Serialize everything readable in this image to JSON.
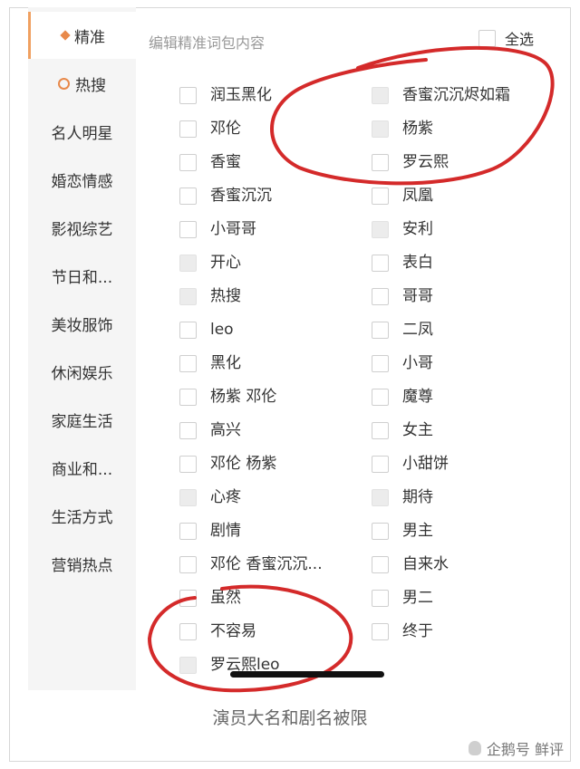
{
  "sidebar": {
    "items": [
      {
        "label": "精准",
        "icon": "diamond-icon",
        "active": true
      },
      {
        "label": "热搜",
        "icon": "flame-icon",
        "active": false
      },
      {
        "label": "名人明星"
      },
      {
        "label": "婚恋情感"
      },
      {
        "label": "影视综艺"
      },
      {
        "label": "节日和..."
      },
      {
        "label": "美妆服饰"
      },
      {
        "label": "休闲娱乐"
      },
      {
        "label": "家庭生活"
      },
      {
        "label": "商业和..."
      },
      {
        "label": "生活方式"
      },
      {
        "label": "营销热点"
      }
    ]
  },
  "header": {
    "title": "编辑精准词包内容",
    "select_all_label": "全选"
  },
  "words": {
    "left": [
      {
        "label": "润玉黑化",
        "disabled": false
      },
      {
        "label": "邓伦",
        "disabled": false
      },
      {
        "label": "香蜜",
        "disabled": false
      },
      {
        "label": "香蜜沉沉",
        "disabled": false
      },
      {
        "label": "小哥哥",
        "disabled": false
      },
      {
        "label": "开心",
        "disabled": true
      },
      {
        "label": "热搜",
        "disabled": true
      },
      {
        "label": "leo",
        "disabled": false
      },
      {
        "label": "黑化",
        "disabled": false
      },
      {
        "label": "杨紫 邓伦",
        "disabled": false
      },
      {
        "label": "高兴",
        "disabled": false
      },
      {
        "label": "邓伦 杨紫",
        "disabled": false
      },
      {
        "label": "心疼",
        "disabled": true
      },
      {
        "label": "剧情",
        "disabled": false
      },
      {
        "label": "邓伦 香蜜沉沉...",
        "disabled": false
      },
      {
        "label": "虽然",
        "disabled": false
      },
      {
        "label": "不容易",
        "disabled": false
      },
      {
        "label": "罗云熙leo",
        "disabled": true
      }
    ],
    "right": [
      {
        "label": "香蜜沉沉烬如霜",
        "disabled": true
      },
      {
        "label": "杨紫",
        "disabled": true
      },
      {
        "label": "罗云熙",
        "disabled": false
      },
      {
        "label": "凤凰",
        "disabled": false
      },
      {
        "label": "安利",
        "disabled": true
      },
      {
        "label": "表白",
        "disabled": false
      },
      {
        "label": "哥哥",
        "disabled": false
      },
      {
        "label": "二凤",
        "disabled": false
      },
      {
        "label": "小哥",
        "disabled": false
      },
      {
        "label": "魔尊",
        "disabled": false
      },
      {
        "label": "女主",
        "disabled": false
      },
      {
        "label": "小甜饼",
        "disabled": false
      },
      {
        "label": "期待",
        "disabled": true
      },
      {
        "label": "男主",
        "disabled": false
      },
      {
        "label": "自来水",
        "disabled": false
      },
      {
        "label": "男二",
        "disabled": false
      },
      {
        "label": "终于",
        "disabled": false
      }
    ]
  },
  "annotation": {
    "circle_color": "#d42a2a"
  },
  "caption": "演员大名和剧名被限",
  "watermark": "企鹅号 鲜评"
}
